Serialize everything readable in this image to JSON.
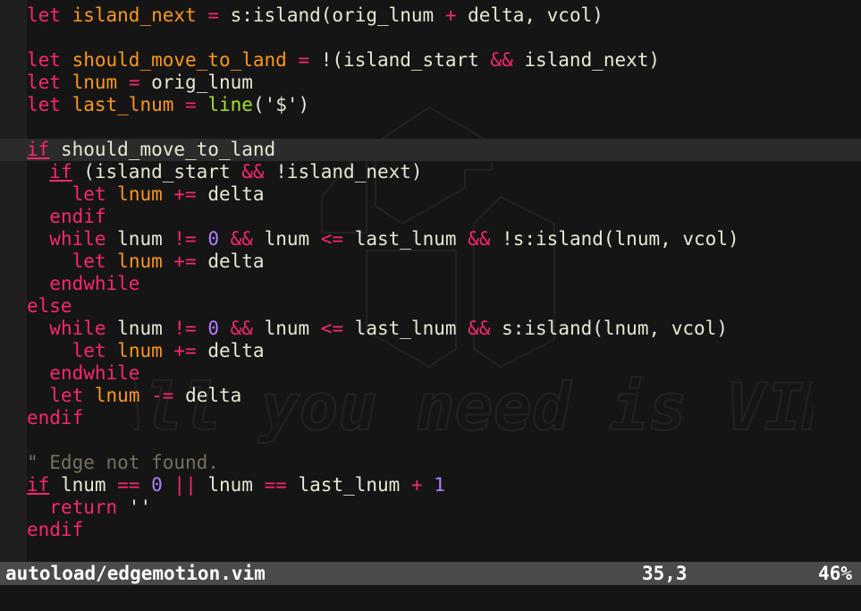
{
  "editor": {
    "lines": [
      [
        {
          "t": "let",
          "c": "kw"
        },
        {
          "t": " "
        },
        {
          "t": "island_next",
          "c": "var"
        },
        {
          "t": " "
        },
        {
          "t": "=",
          "c": "op"
        },
        {
          "t": " s:island(orig_lnum "
        },
        {
          "t": "+",
          "c": "op"
        },
        {
          "t": " delta, vcol)"
        }
      ],
      [],
      [
        {
          "t": "let",
          "c": "kw"
        },
        {
          "t": " "
        },
        {
          "t": "should_move_to_land",
          "c": "var"
        },
        {
          "t": " "
        },
        {
          "t": "=",
          "c": "op"
        },
        {
          "t": " !(island_start "
        },
        {
          "t": "&&",
          "c": "op"
        },
        {
          "t": " island_next)"
        }
      ],
      [
        {
          "t": "let",
          "c": "kw"
        },
        {
          "t": " "
        },
        {
          "t": "lnum",
          "c": "var"
        },
        {
          "t": " "
        },
        {
          "t": "=",
          "c": "op"
        },
        {
          "t": " orig_lnum"
        }
      ],
      [
        {
          "t": "let",
          "c": "kw"
        },
        {
          "t": " "
        },
        {
          "t": "last_lnum",
          "c": "var"
        },
        {
          "t": " "
        },
        {
          "t": "=",
          "c": "op"
        },
        {
          "t": " "
        },
        {
          "t": "line",
          "c": "fn"
        },
        {
          "t": "('$')"
        }
      ],
      [],
      [
        {
          "t": "if",
          "c": "kw u"
        },
        {
          "t": " should_move_to_land"
        }
      ],
      [
        {
          "t": "  "
        },
        {
          "t": "if",
          "c": "kw u"
        },
        {
          "t": " (island_start "
        },
        {
          "t": "&&",
          "c": "op"
        },
        {
          "t": " !island_next)"
        }
      ],
      [
        {
          "t": "    "
        },
        {
          "t": "let",
          "c": "kw"
        },
        {
          "t": " "
        },
        {
          "t": "lnum",
          "c": "var"
        },
        {
          "t": " "
        },
        {
          "t": "+=",
          "c": "op"
        },
        {
          "t": " delta"
        }
      ],
      [
        {
          "t": "  "
        },
        {
          "t": "endif",
          "c": "kw"
        }
      ],
      [
        {
          "t": "  "
        },
        {
          "t": "while",
          "c": "kw"
        },
        {
          "t": " lnum "
        },
        {
          "t": "!=",
          "c": "op"
        },
        {
          "t": " "
        },
        {
          "t": "0",
          "c": "num"
        },
        {
          "t": " "
        },
        {
          "t": "&&",
          "c": "op"
        },
        {
          "t": " lnum "
        },
        {
          "t": "<=",
          "c": "op"
        },
        {
          "t": " last_lnum "
        },
        {
          "t": "&&",
          "c": "op"
        },
        {
          "t": " !s:island(lnum, vcol)"
        }
      ],
      [
        {
          "t": "    "
        },
        {
          "t": "let",
          "c": "kw"
        },
        {
          "t": " "
        },
        {
          "t": "lnum",
          "c": "var"
        },
        {
          "t": " "
        },
        {
          "t": "+=",
          "c": "op"
        },
        {
          "t": " delta"
        }
      ],
      [
        {
          "t": "  "
        },
        {
          "t": "endwhile",
          "c": "kw"
        }
      ],
      [
        {
          "t": "else",
          "c": "kw"
        }
      ],
      [
        {
          "t": "  "
        },
        {
          "t": "while",
          "c": "kw"
        },
        {
          "t": " lnum "
        },
        {
          "t": "!=",
          "c": "op"
        },
        {
          "t": " "
        },
        {
          "t": "0",
          "c": "num"
        },
        {
          "t": " "
        },
        {
          "t": "&&",
          "c": "op"
        },
        {
          "t": " lnum "
        },
        {
          "t": "<=",
          "c": "op"
        },
        {
          "t": " last_lnum "
        },
        {
          "t": "&&",
          "c": "op"
        },
        {
          "t": " s:island(lnum, vcol)"
        }
      ],
      [
        {
          "t": "    "
        },
        {
          "t": "let",
          "c": "kw"
        },
        {
          "t": " "
        },
        {
          "t": "lnum",
          "c": "var"
        },
        {
          "t": " "
        },
        {
          "t": "+=",
          "c": "op"
        },
        {
          "t": " delta"
        }
      ],
      [
        {
          "t": "  "
        },
        {
          "t": "endwhile",
          "c": "kw"
        }
      ],
      [
        {
          "t": "  "
        },
        {
          "t": "let",
          "c": "kw"
        },
        {
          "t": " "
        },
        {
          "t": "lnum",
          "c": "var"
        },
        {
          "t": " "
        },
        {
          "t": "-=",
          "c": "op"
        },
        {
          "t": " delta"
        }
      ],
      [
        {
          "t": "endif",
          "c": "kw"
        }
      ],
      [],
      [
        {
          "t": "\" Edge not found.",
          "c": "cmt"
        }
      ],
      [
        {
          "t": "if",
          "c": "kw u"
        },
        {
          "t": " lnum "
        },
        {
          "t": "==",
          "c": "op"
        },
        {
          "t": " "
        },
        {
          "t": "0",
          "c": "num"
        },
        {
          "t": " "
        },
        {
          "t": "||",
          "c": "op"
        },
        {
          "t": " lnum "
        },
        {
          "t": "==",
          "c": "op"
        },
        {
          "t": " last_lnum "
        },
        {
          "t": "+",
          "c": "op"
        },
        {
          "t": " "
        },
        {
          "t": "1",
          "c": "num"
        }
      ],
      [
        {
          "t": "  "
        },
        {
          "t": "return",
          "c": "kw"
        },
        {
          "t": " ''"
        }
      ],
      [
        {
          "t": "endif",
          "c": "kw"
        }
      ],
      []
    ],
    "cursor_line_index": 6
  },
  "watermark": {
    "text": "All you need is VIM"
  },
  "statusline": {
    "filename": "autoload/edgemotion.vim",
    "position": "35,3",
    "percent": "46%"
  },
  "colors": {
    "background": "#151515",
    "keyword": "#f92672",
    "variable": "#fd971f",
    "number": "#ae81ff",
    "function": "#a6e22e",
    "comment": "#75715e",
    "statusline_bg": "#4a4a4a"
  }
}
